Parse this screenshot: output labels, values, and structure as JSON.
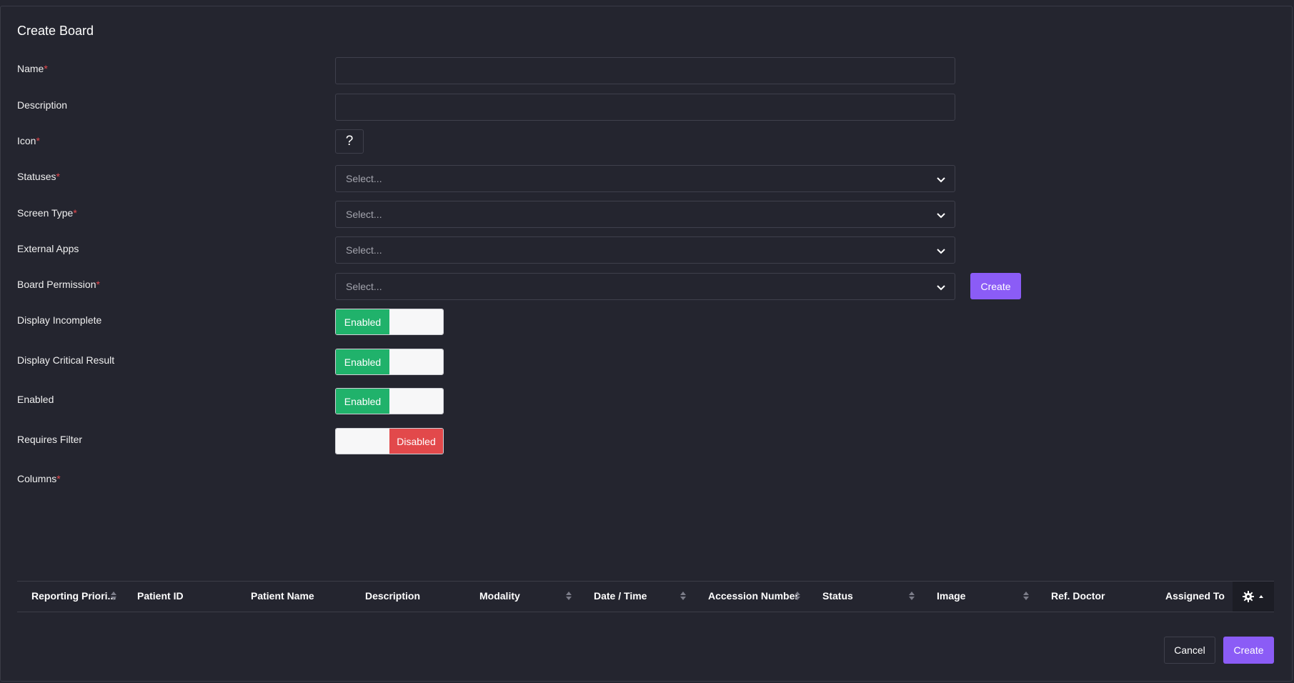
{
  "dialog": {
    "title": "Create Board"
  },
  "fields": {
    "name": {
      "label": "Name",
      "required": "*",
      "value": ""
    },
    "description": {
      "label": "Description",
      "value": ""
    },
    "icon": {
      "label": "Icon",
      "required": "*",
      "glyph": "?"
    },
    "statuses": {
      "label": "Statuses",
      "required": "*",
      "placeholder": "Select..."
    },
    "screen_type": {
      "label": "Screen Type",
      "required": "*",
      "placeholder": "Select..."
    },
    "external_apps": {
      "label": "External Apps",
      "placeholder": "Select..."
    },
    "board_permission": {
      "label": "Board Permission",
      "required": "*",
      "placeholder": "Select...",
      "create_label": "Create"
    },
    "display_incomplete": {
      "label": "Display Incomplete",
      "state": "Enabled"
    },
    "display_critical_result": {
      "label": "Display Critical Result",
      "state": "Enabled"
    },
    "enabled": {
      "label": "Enabled",
      "state": "Enabled"
    },
    "requires_filter": {
      "label": "Requires Filter",
      "state": "Disabled"
    },
    "columns": {
      "label": "Columns",
      "required": "*"
    }
  },
  "table": {
    "headers": [
      {
        "label": "Reporting Priori...",
        "sortable": true
      },
      {
        "label": "Patient ID",
        "sortable": false
      },
      {
        "label": "Patient Name",
        "sortable": false
      },
      {
        "label": "Description",
        "sortable": false
      },
      {
        "label": "Modality",
        "sortable": true
      },
      {
        "label": "Date / Time",
        "sortable": true
      },
      {
        "label": "Accession Number",
        "sortable": true
      },
      {
        "label": "Status",
        "sortable": true
      },
      {
        "label": "Image",
        "sortable": true
      },
      {
        "label": "Ref. Doctor",
        "sortable": false
      },
      {
        "label": "Assigned To",
        "sortable": false
      }
    ]
  },
  "footer": {
    "cancel_label": "Cancel",
    "create_label": "Create"
  },
  "colors": {
    "accent": "#8b5cf6",
    "enabled": "#20b26b",
    "disabled": "#e2494b",
    "required": "#e5484d",
    "background": "#24252f"
  },
  "icons": {
    "chevron": "chevron-down-icon",
    "gear": "gear-icon",
    "sort": "sort-icon",
    "caret": "caret-up-icon"
  }
}
